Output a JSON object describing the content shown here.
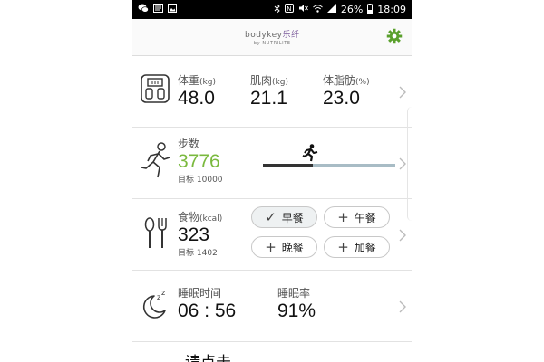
{
  "status_bar": {
    "battery_percent": "26%",
    "time": "18:09"
  },
  "header": {
    "logo_main": "bodykey",
    "logo_cn": "乐纤",
    "logo_sub": "by NUTRILITE",
    "settings_icon": "gear-icon",
    "accent_color": "#5aa02c"
  },
  "body_stats": {
    "weight": {
      "label": "体重",
      "unit": "(kg)",
      "value": "48.0"
    },
    "muscle": {
      "label": "肌肉",
      "unit": "(kg)",
      "value": "21.1"
    },
    "body_fat": {
      "label": "体脂肪",
      "unit": "(%)",
      "value": "23.0"
    }
  },
  "steps": {
    "label": "步数",
    "value": "3776",
    "goal_label": "目标",
    "goal_value": "10000",
    "progress_fraction": 0.3776
  },
  "food": {
    "label": "食物",
    "unit": "(kcal)",
    "value": "323",
    "goal_label": "目标",
    "goal_value": "1402",
    "meals": [
      {
        "label": "早餐",
        "state": "checked"
      },
      {
        "label": "午餐",
        "state": "add"
      },
      {
        "label": "晚餐",
        "state": "add"
      },
      {
        "label": "加餐",
        "state": "add"
      }
    ]
  },
  "sleep": {
    "time_label": "睡眠时间",
    "time_value": "06 : 56",
    "rate_label": "睡眠率",
    "rate_value": "91%"
  },
  "partial_text": "请点击"
}
